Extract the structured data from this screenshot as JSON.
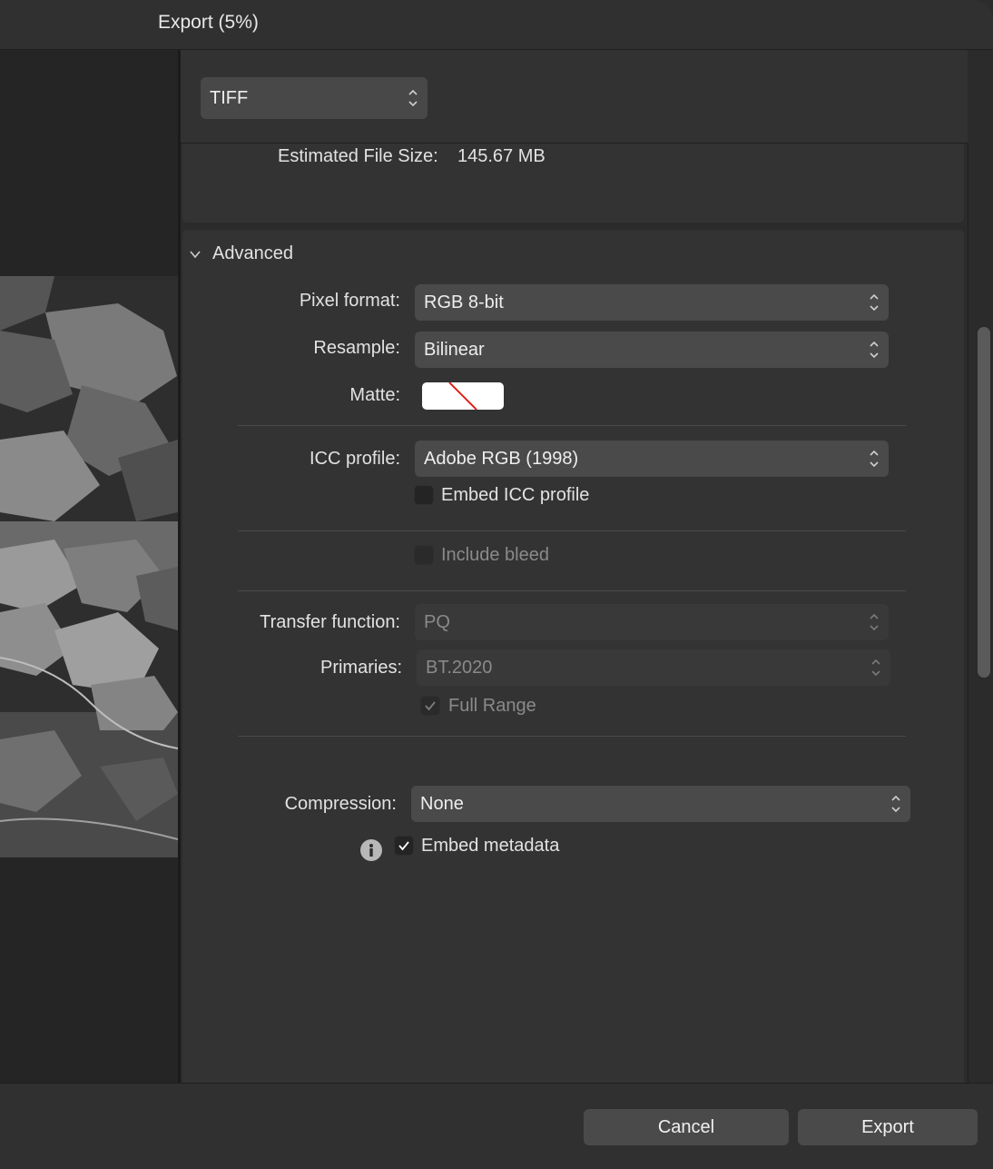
{
  "window": {
    "title": "Export (5%)"
  },
  "format": {
    "selected": "TIFF"
  },
  "estimate": {
    "label": "Estimated File Size:",
    "value": "145.67 MB"
  },
  "advanced": {
    "header": "Advanced",
    "pixel_format": {
      "label": "Pixel format:",
      "value": "RGB 8-bit"
    },
    "resample": {
      "label": "Resample:",
      "value": "Bilinear"
    },
    "matte": {
      "label": "Matte:"
    },
    "icc_profile": {
      "label": "ICC profile:",
      "value": "Adobe RGB (1998)"
    },
    "embed_icc": {
      "label": "Embed ICC profile",
      "checked": false
    },
    "include_bleed": {
      "label": "Include bleed",
      "checked": false
    },
    "transfer_function": {
      "label": "Transfer function:",
      "value": "PQ"
    },
    "primaries": {
      "label": "Primaries:",
      "value": "BT.2020"
    },
    "full_range": {
      "label": "Full Range",
      "checked": true
    },
    "compression": {
      "label": "Compression:",
      "value": "None"
    },
    "embed_metadata": {
      "label": "Embed metadata",
      "checked": true
    }
  },
  "footer": {
    "cancel": "Cancel",
    "export": "Export"
  },
  "icons": {
    "collapse": "chevron-down-icon",
    "select": "updown-chevron-icon",
    "info": "info-icon",
    "check": "checkmark-icon"
  }
}
